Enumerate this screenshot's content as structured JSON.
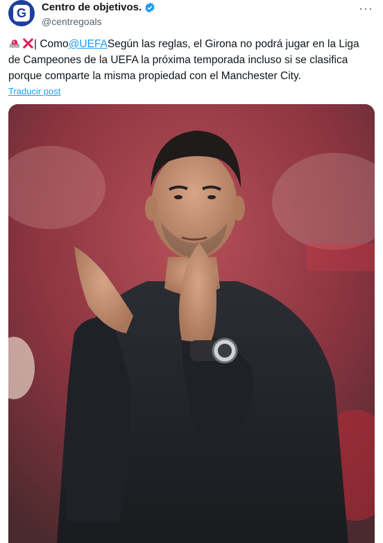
{
  "header": {
    "display_name": "Centro de objetivos.",
    "handle": "@centregoals",
    "avatar_letter": "G"
  },
  "tweet": {
    "text_before_mention": "| Como",
    "mention": "@UEFA",
    "text_after_mention": "Según las reglas, el Girona no podrá jugar en la Liga de Campeones de la UEFA la próxima temporada incluso si se clasifica porque comparte la misma propiedad con el Manchester City."
  },
  "translate_label": "Traducir post",
  "icons": {
    "verified": "verified-badge-icon",
    "more": "more-options-icon",
    "alarm": "police-light-emoji-icon",
    "cross": "cross-mark-emoji-icon"
  },
  "colors": {
    "link": "#1d9bf0",
    "secondary_text": "#536471",
    "avatar_bg": "#1d3f9e"
  }
}
